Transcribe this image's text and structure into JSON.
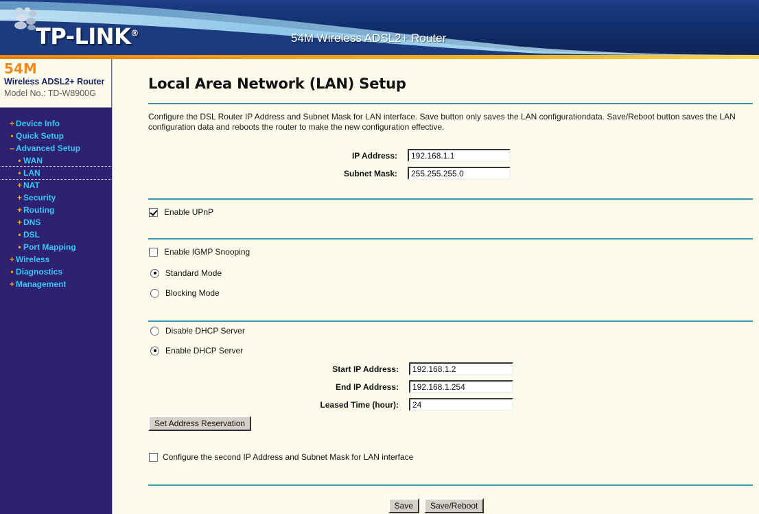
{
  "header": {
    "logo_text": "TP-LINK",
    "logo_reg": "®",
    "product_title": "54M Wireless ADSL2+ Router"
  },
  "sidebar": {
    "brand_speed": "54M",
    "brand_product": "Wireless ADSL2+ Router",
    "brand_model": "Model No.: TD-W8900G",
    "items": [
      {
        "label": "Device Info",
        "bullet": "+",
        "level": 0,
        "selected": false
      },
      {
        "label": "Quick Setup",
        "bullet": "•",
        "level": 0,
        "selected": false
      },
      {
        "label": "Advanced Setup",
        "bullet": "–",
        "level": 0,
        "selected": false
      },
      {
        "label": "WAN",
        "bullet": "•",
        "level": 1,
        "selected": false
      },
      {
        "label": "LAN",
        "bullet": "•",
        "level": 1,
        "selected": true
      },
      {
        "label": "NAT",
        "bullet": "+",
        "level": 1,
        "selected": false
      },
      {
        "label": "Security",
        "bullet": "+",
        "level": 1,
        "selected": false
      },
      {
        "label": "Routing",
        "bullet": "+",
        "level": 1,
        "selected": false
      },
      {
        "label": "DNS",
        "bullet": "+",
        "level": 1,
        "selected": false
      },
      {
        "label": "DSL",
        "bullet": "•",
        "level": 1,
        "selected": false
      },
      {
        "label": "Port Mapping",
        "bullet": "•",
        "level": 1,
        "selected": false
      },
      {
        "label": "Wireless",
        "bullet": "+",
        "level": 0,
        "selected": false
      },
      {
        "label": "Diagnostics",
        "bullet": "•",
        "level": 0,
        "selected": false
      },
      {
        "label": "Management",
        "bullet": "+",
        "level": 0,
        "selected": false
      }
    ]
  },
  "main": {
    "title": "Local Area Network (LAN) Setup",
    "description": "Configure the DSL Router IP Address and Subnet Mask for LAN interface.  Save button only saves the LAN configurationdata.  Save/Reboot button saves the LAN configuration data and reboots the router to make the new configuration effective.",
    "ip_address_label": "IP Address:",
    "ip_address_value": "192.168.1.1",
    "subnet_mask_label": "Subnet Mask:",
    "subnet_mask_value": "255.255.255.0",
    "enable_upnp_label": "Enable UPnP",
    "enable_upnp_checked": true,
    "enable_igmp_label": "Enable IGMP Snooping",
    "enable_igmp_checked": false,
    "standard_mode_label": "Standard Mode",
    "standard_mode_selected": true,
    "blocking_mode_label": "Blocking Mode",
    "blocking_mode_selected": false,
    "disable_dhcp_label": "Disable DHCP Server",
    "disable_dhcp_selected": false,
    "enable_dhcp_label": "Enable DHCP Server",
    "enable_dhcp_selected": true,
    "start_ip_label": "Start IP Address:",
    "start_ip_value": "192.168.1.2",
    "end_ip_label": "End IP Address:",
    "end_ip_value": "192.168.1.254",
    "leased_time_label": "Leased Time (hour):",
    "leased_time_value": "24",
    "set_address_reservation_label": "Set Address Reservation",
    "second_ip_label": "Configure the second IP Address and Subnet Mask for LAN interface",
    "second_ip_checked": false,
    "save_label": "Save",
    "save_reboot_label": "Save/Reboot"
  },
  "colors": {
    "header_navy": "#132E6B",
    "wave_light_blue": "#8FC7E8",
    "orange_bar": "#F09015",
    "sidebar_purple": "#2E2171",
    "menu_cyan": "#35C8F5",
    "bullet_orange": "#F2A81D",
    "brand_orange": "#F08A1C",
    "rule_teal": "#3A9AA8",
    "content_cream": "#FDFCEC"
  }
}
